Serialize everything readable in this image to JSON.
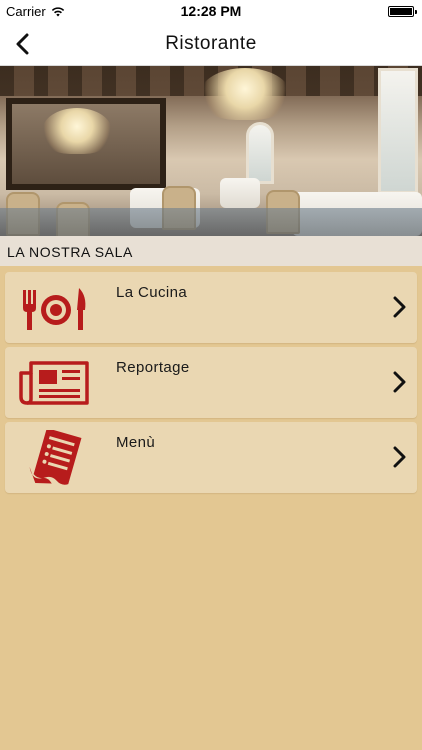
{
  "status_bar": {
    "carrier": "Carrier",
    "time": "12:28 PM"
  },
  "nav": {
    "title": "Ristorante"
  },
  "hero": {
    "section_label": "LA NOSTRA SALA"
  },
  "menu": [
    {
      "label": "La Cucina",
      "icon": "cutlery-plate-icon"
    },
    {
      "label": "Reportage",
      "icon": "newspaper-icon"
    },
    {
      "label": "Menù",
      "icon": "menu-document-icon"
    }
  ],
  "colors": {
    "background": "#e3c792",
    "card": "#ead7b2",
    "icon_red": "#b71c1c",
    "header": "#ffffff"
  }
}
